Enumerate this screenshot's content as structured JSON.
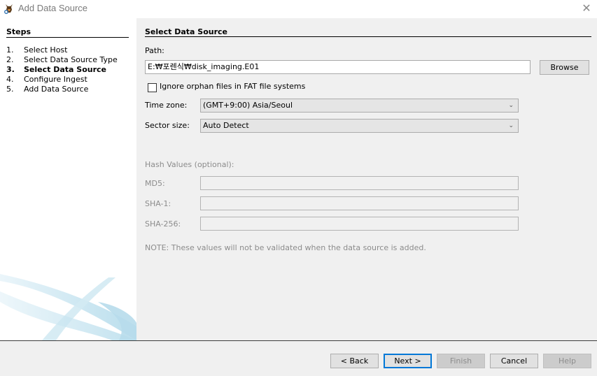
{
  "window": {
    "title": "Add Data Source",
    "app_icon": "autopsy-dog-icon",
    "close_icon": "close-icon",
    "close_glyph": "✕"
  },
  "steps": {
    "title": "Steps",
    "items": [
      {
        "num": "1.",
        "label": "Select Host",
        "active": false
      },
      {
        "num": "2.",
        "label": "Select Data Source Type",
        "active": false
      },
      {
        "num": "3.",
        "label": "Select Data Source",
        "active": true
      },
      {
        "num": "4.",
        "label": "Configure Ingest",
        "active": false
      },
      {
        "num": "5.",
        "label": "Add Data Source",
        "active": false
      }
    ]
  },
  "main": {
    "section_title": "Select Data Source",
    "path_label": "Path:",
    "path_value": "E:₩포렌식₩disk_imaging.E01",
    "browse_label": "Browse",
    "ignore_orphan_label": "Ignore orphan files in FAT file systems",
    "ignore_orphan_checked": false,
    "timezone_label": "Time zone:",
    "timezone_value": "(GMT+9:00) Asia/Seoul",
    "sector_label": "Sector size:",
    "sector_value": "Auto Detect",
    "chevron_glyph": "⌄",
    "hash_title": "Hash Values (optional):",
    "md5_label": "MD5:",
    "md5_value": "",
    "sha1_label": "SHA-1:",
    "sha1_value": "",
    "sha256_label": "SHA-256:",
    "sha256_value": "",
    "note": "NOTE: These values will not be validated when the data source is added."
  },
  "footer": {
    "back_label": "< Back",
    "next_label": "Next >",
    "finish_label": "Finish",
    "cancel_label": "Cancel",
    "help_label": "Help"
  },
  "colors": {
    "focus_border": "#0078d7",
    "disabled_button": "#cccccc",
    "swoosh": "#bfe0ee"
  }
}
